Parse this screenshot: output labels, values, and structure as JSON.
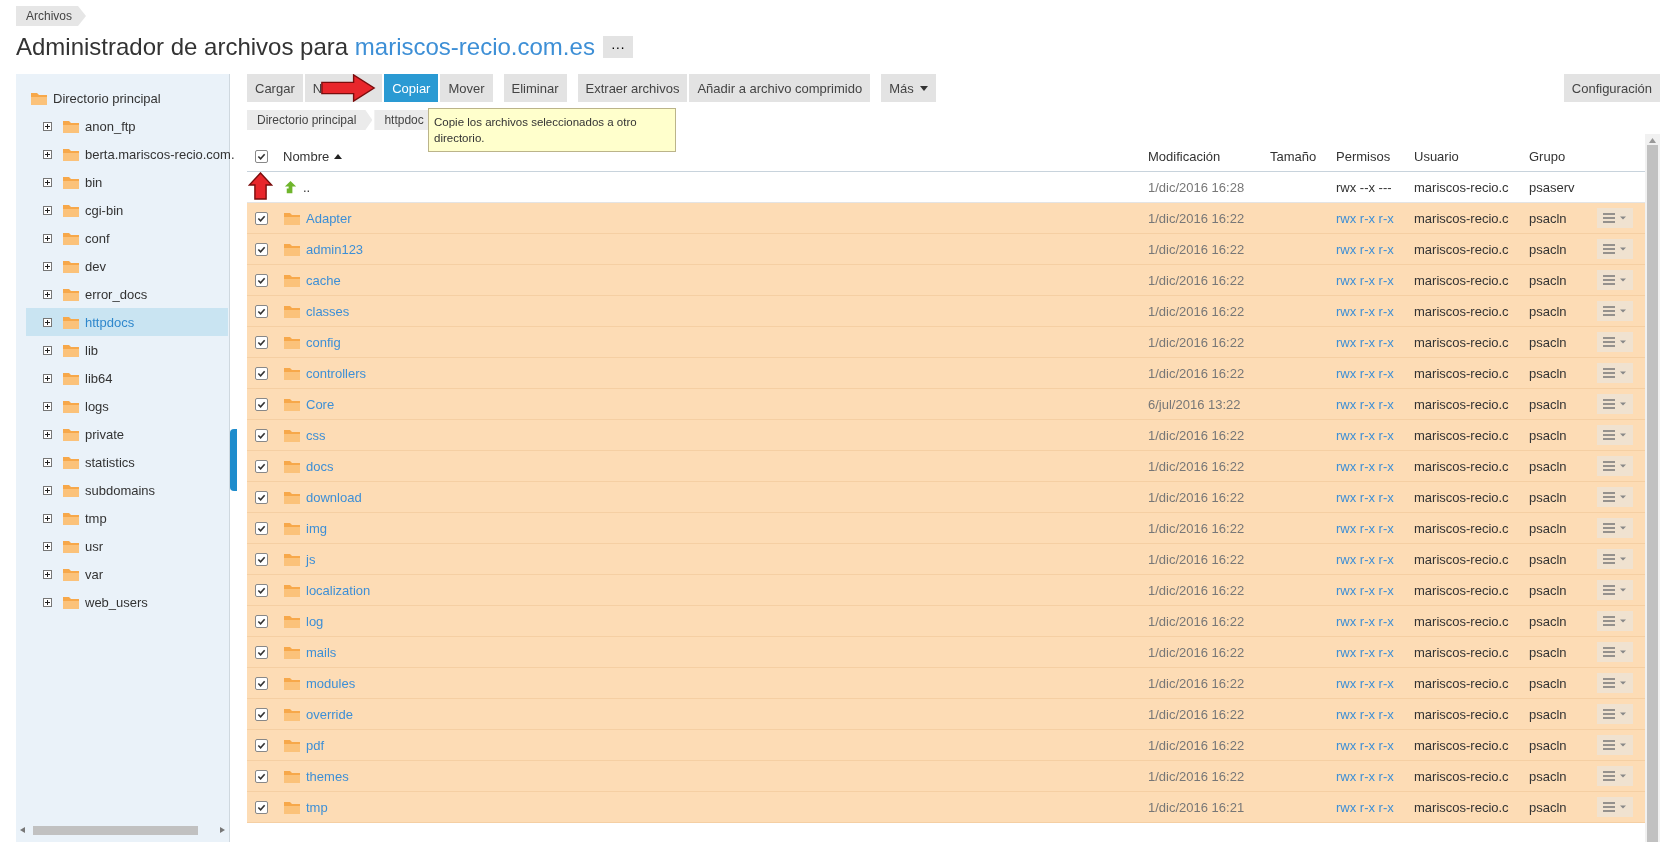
{
  "breadcrumb": "Archivos",
  "title": {
    "text": "Administrador de archivos para",
    "domain": "mariscos-recio.com.es",
    "more": "···"
  },
  "sidebar": {
    "root": "Directorio principal",
    "items": [
      {
        "label": "anon_ftp",
        "selected": false
      },
      {
        "label": "berta.mariscos-recio.com.",
        "selected": false
      },
      {
        "label": "bin",
        "selected": false
      },
      {
        "label": "cgi-bin",
        "selected": false
      },
      {
        "label": "conf",
        "selected": false
      },
      {
        "label": "dev",
        "selected": false
      },
      {
        "label": "error_docs",
        "selected": false
      },
      {
        "label": "httpdocs",
        "selected": true
      },
      {
        "label": "lib",
        "selected": false
      },
      {
        "label": "lib64",
        "selected": false
      },
      {
        "label": "logs",
        "selected": false
      },
      {
        "label": "private",
        "selected": false
      },
      {
        "label": "statistics",
        "selected": false
      },
      {
        "label": "subdomains",
        "selected": false
      },
      {
        "label": "tmp",
        "selected": false
      },
      {
        "label": "usr",
        "selected": false
      },
      {
        "label": "var",
        "selected": false
      },
      {
        "label": "web_users",
        "selected": false
      }
    ]
  },
  "toolbar": [
    {
      "label": "Cargar",
      "selected": false,
      "dropdown": false
    },
    {
      "label": "N",
      "selected": false,
      "dropdown": false
    },
    {
      "label": "Copiar",
      "selected": true,
      "dropdown": false
    },
    {
      "label": "Mover",
      "selected": false,
      "dropdown": false
    },
    {
      "label": "Eliminar",
      "selected": false,
      "dropdown": false
    },
    {
      "label": "Extraer archivos",
      "selected": false,
      "dropdown": false
    },
    {
      "label": "Añadir a archivo comprimido",
      "selected": false,
      "dropdown": false
    },
    {
      "label": "Más",
      "selected": false,
      "dropdown": true
    }
  ],
  "settings_button": "Configuración",
  "path": [
    "Directorio principal",
    "httpdoc"
  ],
  "tooltip": "Copie los archivos seleccionados a otro directorio.",
  "table": {
    "select_all_checked": true,
    "columns": [
      "Nombre",
      "Modificación",
      "Tamaño",
      "Permisos",
      "Usuario",
      "Grupo"
    ],
    "rows": [
      {
        "kind": "parent",
        "name": "..",
        "modified": "1/dic/2016 16:28",
        "permissions": "rwx --x ---",
        "user": "mariscos-recio.c",
        "group": "psaserv",
        "selected": false
      },
      {
        "kind": "folder",
        "name": "Adapter",
        "modified": "1/dic/2016 16:22",
        "permissions": "rwx r-x r-x",
        "user": "mariscos-recio.c",
        "group": "psacln",
        "selected": true
      },
      {
        "kind": "folder",
        "name": "admin123",
        "modified": "1/dic/2016 16:22",
        "permissions": "rwx r-x r-x",
        "user": "mariscos-recio.c",
        "group": "psacln",
        "selected": true
      },
      {
        "kind": "folder",
        "name": "cache",
        "modified": "1/dic/2016 16:22",
        "permissions": "rwx r-x r-x",
        "user": "mariscos-recio.c",
        "group": "psacln",
        "selected": true
      },
      {
        "kind": "folder",
        "name": "classes",
        "modified": "1/dic/2016 16:22",
        "permissions": "rwx r-x r-x",
        "user": "mariscos-recio.c",
        "group": "psacln",
        "selected": true
      },
      {
        "kind": "folder",
        "name": "config",
        "modified": "1/dic/2016 16:22",
        "permissions": "rwx r-x r-x",
        "user": "mariscos-recio.c",
        "group": "psacln",
        "selected": true
      },
      {
        "kind": "folder",
        "name": "controllers",
        "modified": "1/dic/2016 16:22",
        "permissions": "rwx r-x r-x",
        "user": "mariscos-recio.c",
        "group": "psacln",
        "selected": true
      },
      {
        "kind": "folder",
        "name": "Core",
        "modified": "6/jul/2016 13:22",
        "permissions": "rwx r-x r-x",
        "user": "mariscos-recio.c",
        "group": "psacln",
        "selected": true
      },
      {
        "kind": "folder",
        "name": "css",
        "modified": "1/dic/2016 16:22",
        "permissions": "rwx r-x r-x",
        "user": "mariscos-recio.c",
        "group": "psacln",
        "selected": true
      },
      {
        "kind": "folder",
        "name": "docs",
        "modified": "1/dic/2016 16:22",
        "permissions": "rwx r-x r-x",
        "user": "mariscos-recio.c",
        "group": "psacln",
        "selected": true
      },
      {
        "kind": "folder",
        "name": "download",
        "modified": "1/dic/2016 16:22",
        "permissions": "rwx r-x r-x",
        "user": "mariscos-recio.c",
        "group": "psacln",
        "selected": true
      },
      {
        "kind": "folder",
        "name": "img",
        "modified": "1/dic/2016 16:22",
        "permissions": "rwx r-x r-x",
        "user": "mariscos-recio.c",
        "group": "psacln",
        "selected": true
      },
      {
        "kind": "folder",
        "name": "js",
        "modified": "1/dic/2016 16:22",
        "permissions": "rwx r-x r-x",
        "user": "mariscos-recio.c",
        "group": "psacln",
        "selected": true
      },
      {
        "kind": "folder",
        "name": "localization",
        "modified": "1/dic/2016 16:22",
        "permissions": "rwx r-x r-x",
        "user": "mariscos-recio.c",
        "group": "psacln",
        "selected": true
      },
      {
        "kind": "folder",
        "name": "log",
        "modified": "1/dic/2016 16:22",
        "permissions": "rwx r-x r-x",
        "user": "mariscos-recio.c",
        "group": "psacln",
        "selected": true
      },
      {
        "kind": "folder",
        "name": "mails",
        "modified": "1/dic/2016 16:22",
        "permissions": "rwx r-x r-x",
        "user": "mariscos-recio.c",
        "group": "psacln",
        "selected": true
      },
      {
        "kind": "folder",
        "name": "modules",
        "modified": "1/dic/2016 16:22",
        "permissions": "rwx r-x r-x",
        "user": "mariscos-recio.c",
        "group": "psacln",
        "selected": true
      },
      {
        "kind": "folder",
        "name": "override",
        "modified": "1/dic/2016 16:22",
        "permissions": "rwx r-x r-x",
        "user": "mariscos-recio.c",
        "group": "psacln",
        "selected": true
      },
      {
        "kind": "folder",
        "name": "pdf",
        "modified": "1/dic/2016 16:22",
        "permissions": "rwx r-x r-x",
        "user": "mariscos-recio.c",
        "group": "psacln",
        "selected": true
      },
      {
        "kind": "folder",
        "name": "themes",
        "modified": "1/dic/2016 16:22",
        "permissions": "rwx r-x r-x",
        "user": "mariscos-recio.c",
        "group": "psacln",
        "selected": true
      },
      {
        "kind": "folder",
        "name": "tmp",
        "modified": "1/dic/2016 16:21",
        "permissions": "rwx r-x r-x",
        "user": "mariscos-recio.c",
        "group": "psacln",
        "selected": true
      }
    ]
  }
}
